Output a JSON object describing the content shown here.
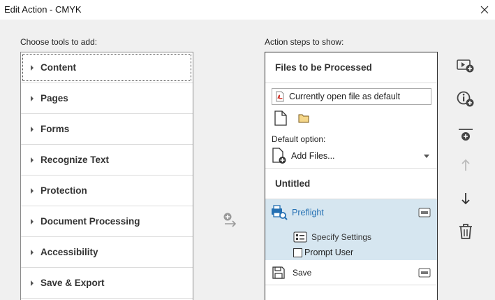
{
  "window": {
    "title": "Edit Action - CMYK"
  },
  "left": {
    "label": "Choose tools to add:",
    "categories": [
      {
        "label": "Content"
      },
      {
        "label": "Pages"
      },
      {
        "label": "Forms"
      },
      {
        "label": "Recognize Text"
      },
      {
        "label": "Protection"
      },
      {
        "label": "Document Processing"
      },
      {
        "label": "Accessibility"
      },
      {
        "label": "Save & Export"
      }
    ]
  },
  "right": {
    "label": "Action steps to show:",
    "files_header": "Files to be Processed",
    "file_source": "Currently open file as default",
    "default_option_label": "Default option:",
    "add_files_value": "Add Files...",
    "untitled_header": "Untitled",
    "steps": [
      {
        "label": "Preflight",
        "sub_label": "Specify Settings",
        "prompt_label": "Prompt User",
        "prompt_checked": false
      },
      {
        "label": "Save"
      }
    ]
  },
  "icons": {
    "close": "close-icon",
    "add_arrow": "add-to-steps-icon",
    "side": [
      "insert-panel-icon",
      "add-instruction-icon",
      "add-divider-icon",
      "move-up-icon",
      "move-down-icon",
      "delete-icon"
    ]
  },
  "colors": {
    "selection": "#d6e6f0",
    "link_blue": "#2470b3",
    "pdf_red": "#d2352b"
  }
}
